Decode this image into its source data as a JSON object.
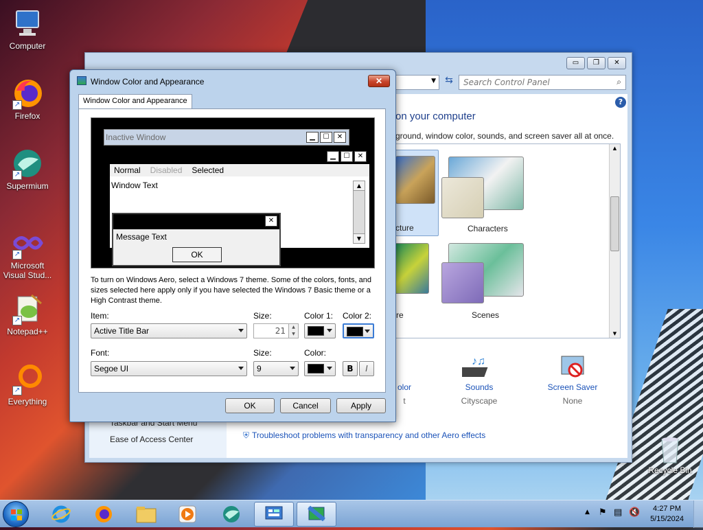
{
  "desktop": {
    "icons": [
      {
        "label": "Computer"
      },
      {
        "label": "Firefox"
      },
      {
        "label": "Supermium"
      },
      {
        "label": "Microsoft Visual Stud..."
      },
      {
        "label": "Notepad++"
      },
      {
        "label": "Everything"
      },
      {
        "label": "Recycle Bin"
      }
    ]
  },
  "control_panel": {
    "search_placeholder": "Search Control Panel",
    "headline": "on your computer",
    "subtitle": "ground, window color, sounds, and screen saver all at once.",
    "themes": [
      {
        "label": "cture"
      },
      {
        "label": "Characters"
      },
      {
        "label": "re"
      },
      {
        "label": "Scenes"
      }
    ],
    "sidebar_links": [
      "Taskbar and Start Menu",
      "Ease of Access Center"
    ],
    "bottom": {
      "color_label": "olor",
      "color_value": "t",
      "sounds_label": "Sounds",
      "sounds_value": "Cityscape",
      "screensaver_label": "Screen Saver",
      "screensaver_value": "None"
    },
    "troubleshoot_link": "Troubleshoot problems with transparency and other Aero effects"
  },
  "dialog": {
    "title": "Window Color and Appearance",
    "close_glyph": "✕",
    "tab": "Window Color and Appearance",
    "preview": {
      "inactive_title": "Inactive Window",
      "menu": {
        "normal": "Normal",
        "disabled": "Disabled",
        "selected": "Selected"
      },
      "window_text": "Window Text",
      "message_text": "Message Text",
      "ok": "OK"
    },
    "info_text": "To turn on Windows Aero, select a Windows 7 theme.  Some of the colors, fonts, and sizes selected here apply only if you have selected the Windows 7 Basic theme or a High Contrast theme.",
    "item_label": "Item:",
    "item_value": "Active Title Bar",
    "size_label": "Size:",
    "size_value": "21",
    "color1_label": "Color 1:",
    "color2_label": "Color 2:",
    "font_label": "Font:",
    "font_value": "Segoe UI",
    "font_size_label": "Size:",
    "font_size_value": "9",
    "font_color_label": "Color:",
    "bold_label": "B",
    "italic_label": "I",
    "buttons": {
      "ok": "OK",
      "cancel": "Cancel",
      "apply": "Apply"
    }
  },
  "taskbar": {
    "time": "4:27 PM",
    "date": "5/15/2024"
  },
  "colors": {
    "link": "#1a52b8",
    "headline": "#1e3f8c",
    "title_close": "#c8452c"
  }
}
